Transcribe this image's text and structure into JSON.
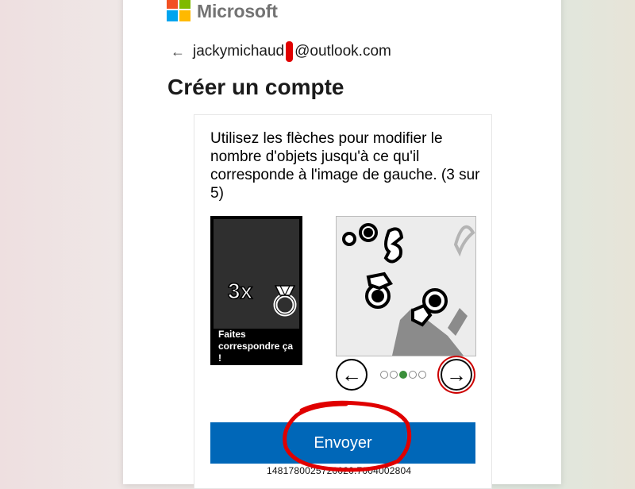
{
  "brand": {
    "name": "Microsoft",
    "logo_colors": [
      "#f25022",
      "#7fba00",
      "#00a4ef",
      "#ffb900"
    ]
  },
  "identity": {
    "back_icon": "arrow-left-icon",
    "email_start": "jackymichaud",
    "email_end": "@outlook.com"
  },
  "page": {
    "title": "Créer un compte"
  },
  "challenge": {
    "instructions": "Utilisez les flèches pour modifier le nombre d'objets jusqu'à ce qu'il corresponde à l'image de gauche. (3 sur 5)",
    "reference": {
      "count": "3x",
      "caption": "Faites correspondre ça !"
    },
    "nav": {
      "prev_icon": "←",
      "next_icon": "→",
      "total_dots": 5,
      "active_dot": 3
    },
    "submit_label": "Envoyer",
    "session_id": "1481780025720020.7004002804"
  },
  "colors": {
    "primary": "#0067b8",
    "active_dot": "#3a8f3a",
    "annotation": "#e00000"
  }
}
